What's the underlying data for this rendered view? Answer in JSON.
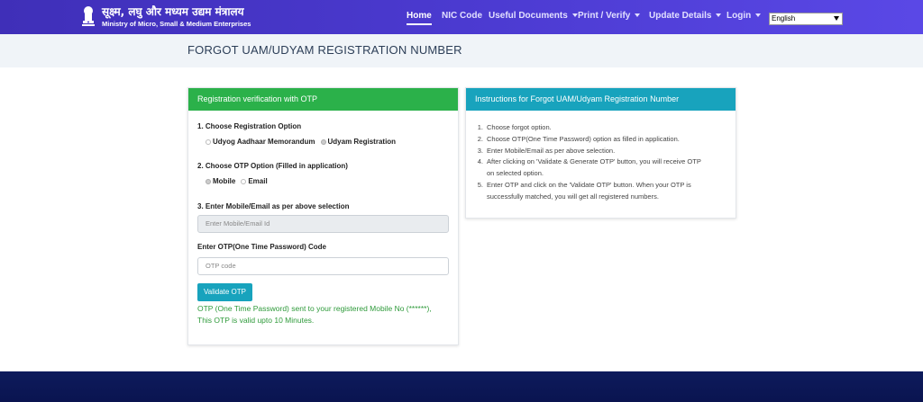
{
  "header": {
    "logo_hindi": "सूक्ष्म, लघु और मध्यम उद्यम मंत्रालय",
    "logo_english": "Ministry of Micro, Small & Medium Enterprises",
    "nav": {
      "home": "Home",
      "nic_code": "NIC Code",
      "useful_documents": "Useful Documents",
      "print_verify": "Print / Verify",
      "update_details": "Update Details",
      "login": "Login"
    },
    "language": "English"
  },
  "page_title": "FORGOT UAM/UDYAM REGISTRATION NUMBER",
  "form": {
    "heading": "Registration verification with OTP",
    "step1_label": "1. Choose Registration Option",
    "option_uam": "Udyog Aadhaar Memorandum",
    "option_udyam": "Udyam Registration",
    "step2_label": "2. Choose OTP Option (Filled in application)",
    "option_mobile": "Mobile",
    "option_email": "Email",
    "step3_label": "3. Enter Mobile/Email as per above selection",
    "mobile_placeholder": "Enter Mobile/Email Id",
    "otp_label": "Enter OTP(One Time Password) Code",
    "otp_placeholder": "OTP code",
    "validate_button": "Validate OTP",
    "otp_message_line1": "OTP (One Time Password) sent to your registered Mobile No (******),",
    "otp_message_line2": "This OTP is valid upto 10 Minutes."
  },
  "instructions": {
    "heading": "Instructions for Forgot UAM/Udyam Registration Number",
    "items": [
      {
        "num": "1.",
        "lines": [
          "Choose forgot option."
        ]
      },
      {
        "num": "2.",
        "lines": [
          "Choose OTP(One Time Password) option as filled in application."
        ]
      },
      {
        "num": "3.",
        "lines": [
          "Enter Mobile/Email as per above selection."
        ]
      },
      {
        "num": "4.",
        "lines": [
          "After clicking on 'Validate & Generate OTP' button, you will receive OTP",
          "on selected option."
        ]
      },
      {
        "num": "5.",
        "lines": [
          "Enter OTP and click on the 'Validate OTP' button. When your OTP is",
          "successfully matched, you will get all registered numbers."
        ]
      }
    ]
  },
  "colors": {
    "nav_bg": "#4b3ad0",
    "form_header": "#2bb14a",
    "instructions_header": "#18a3bd",
    "button": "#18a3bd",
    "otp_message": "#2e9a3a",
    "footer": "#0d1b5c"
  }
}
